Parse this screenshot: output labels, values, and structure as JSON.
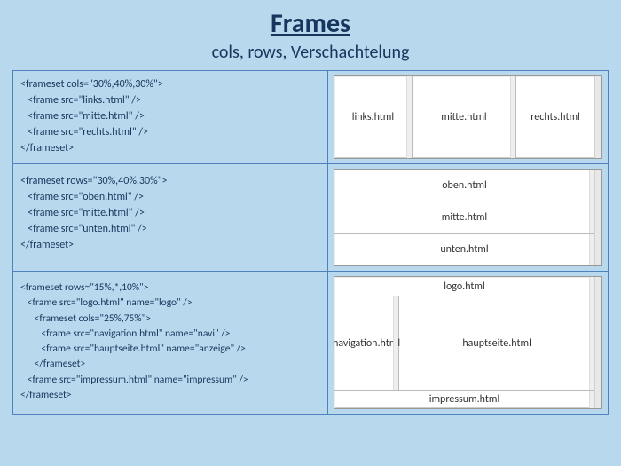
{
  "title": "Frames",
  "subtitle": "cols, rows, Verschachtelung",
  "example1": {
    "code": [
      "<frameset cols=\"30%,40%,30%\">",
      "   <frame src=\"links.html\" />",
      "   <frame src=\"mitte.html\" />",
      "   <frame src=\"rechts.html\" />",
      "</frameset>"
    ],
    "panes": [
      "links.html",
      "mitte.html",
      "rechts.html"
    ]
  },
  "example2": {
    "code": [
      "<frameset rows=\"30%,40%,30%\">",
      "   <frame src=\"oben.html\" />",
      "   <frame src=\"mitte.html\" />",
      "   <frame src=\"unten.html\" />",
      "</frameset>"
    ],
    "panes": [
      "oben.html",
      "mitte.html",
      "unten.html"
    ]
  },
  "example3": {
    "code": [
      "<frameset rows=\"15%,*,10%\">",
      "   <frame src=\"logo.html\" name=\"logo\" />",
      "      <frameset cols=\"25%,75%\">",
      "         <frame src=\"navigation.html\" name=\"navi\" />",
      "         <frame src=\"hauptseite.html\" name=\"anzeige\" />",
      "      </frameset>",
      "   <frame src=\"impressum.html\" name=\"impressum\" />",
      "</frameset>"
    ],
    "top": "logo.html",
    "nav": "navigation.html",
    "main": "hauptseite.html",
    "bottom": "impressum.html"
  }
}
